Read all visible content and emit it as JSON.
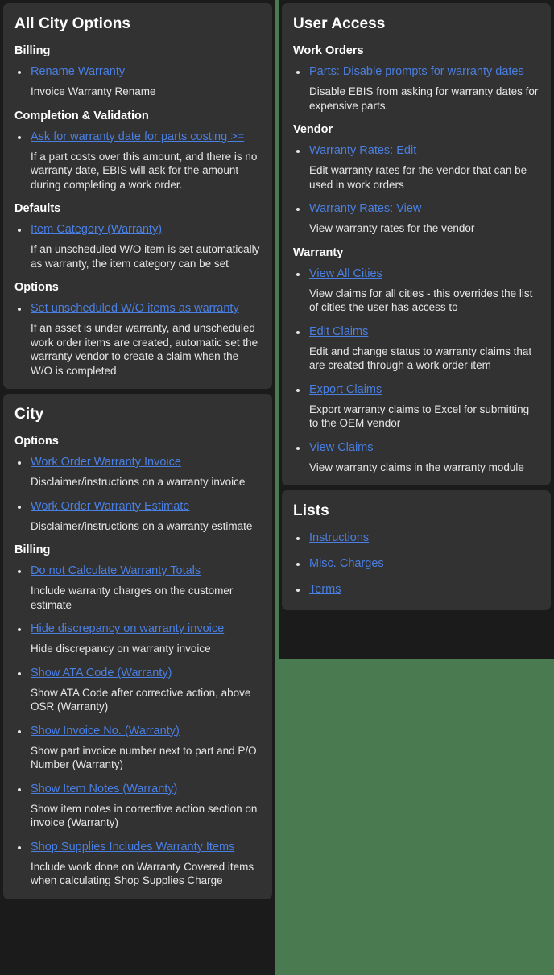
{
  "background_color": "#4a7a50",
  "panel_color": "#1b1b1b",
  "card_color": "#323232",
  "link_color": "#4a7fe3",
  "text_color": "#e7e7e7",
  "columns": {
    "left": {
      "cards": [
        {
          "title": "All City Options",
          "groups": [
            {
              "title": "Billing",
              "items": [
                {
                  "link": "Rename Warranty",
                  "desc": "Invoice Warranty Rename"
                }
              ]
            },
            {
              "title": "Completion & Validation",
              "items": [
                {
                  "link": "Ask for warranty date for parts costing >=",
                  "desc": "If a part costs over this amount, and there is no warranty date, EBIS will ask for the amount during completing a work order."
                }
              ]
            },
            {
              "title": "Defaults",
              "items": [
                {
                  "link": "Item Category (Warranty)",
                  "desc": "If an unscheduled W/O item is set automatically as warranty, the item category can be set"
                }
              ]
            },
            {
              "title": "Options",
              "items": [
                {
                  "link": "Set unscheduled W/O items as warranty",
                  "desc": "If an asset is under warranty, and unscheduled work order items are created, automatic set the warranty vendor to create a claim when the W/O is completed"
                }
              ]
            }
          ]
        },
        {
          "title": "City",
          "groups": [
            {
              "title": "Options",
              "items": [
                {
                  "link": "Work Order Warranty Invoice",
                  "desc": "Disclaimer/instructions on a warranty invoice"
                },
                {
                  "link": "Work Order Warranty Estimate",
                  "desc": "Disclaimer/instructions on a warranty estimate"
                }
              ]
            },
            {
              "title": "Billing",
              "items": [
                {
                  "link": "Do not Calculate Warranty Totals",
                  "desc": "Include warranty charges on the customer estimate"
                },
                {
                  "link": "Hide discrepancy on warranty invoice",
                  "desc": "Hide discrepancy on warranty invoice"
                },
                {
                  "link": "Show ATA Code (Warranty)",
                  "desc": "Show ATA Code after corrective action, above OSR (Warranty)"
                },
                {
                  "link": "Show Invoice No. (Warranty)",
                  "desc": "Show part invoice number next to part and P/O Number (Warranty)"
                },
                {
                  "link": "Show Item Notes (Warranty)",
                  "desc": "Show item notes in corrective action section on invoice (Warranty)"
                },
                {
                  "link": "Shop Supplies Includes Warranty Items",
                  "desc": "Include work done on Warranty Covered items when calculating Shop Supplies Charge"
                }
              ]
            }
          ]
        }
      ]
    },
    "right": {
      "cards": [
        {
          "title": "User Access",
          "groups": [
            {
              "title": "Work Orders",
              "items": [
                {
                  "link": "Parts: Disable prompts for warranty dates",
                  "desc": "Disable EBIS from asking for warranty dates for expensive parts."
                }
              ]
            },
            {
              "title": "Vendor",
              "items": [
                {
                  "link": "Warranty Rates: Edit",
                  "desc": "Edit warranty rates for the vendor that can be used in work orders"
                },
                {
                  "link": "Warranty Rates: View",
                  "desc": "View warranty rates for the vendor"
                }
              ]
            },
            {
              "title": "Warranty",
              "items": [
                {
                  "link": "View All Cities",
                  "desc": "View claims for all cities - this overrides the list of cities the user has access to"
                },
                {
                  "link": "Edit Claims",
                  "desc": "Edit and change status to warranty claims that are created through a work order item"
                },
                {
                  "link": "Export Claims",
                  "desc": "Export warranty claims to Excel for submitting to the OEM vendor"
                },
                {
                  "link": "View Claims",
                  "desc": "View warranty claims in the warranty module"
                }
              ]
            }
          ]
        },
        {
          "title": "Lists",
          "groups": [
            {
              "title": "",
              "items": [
                {
                  "link": "Instructions",
                  "desc": ""
                },
                {
                  "link": "Misc. Charges",
                  "desc": ""
                },
                {
                  "link": "Terms",
                  "desc": ""
                }
              ]
            }
          ]
        }
      ]
    }
  }
}
